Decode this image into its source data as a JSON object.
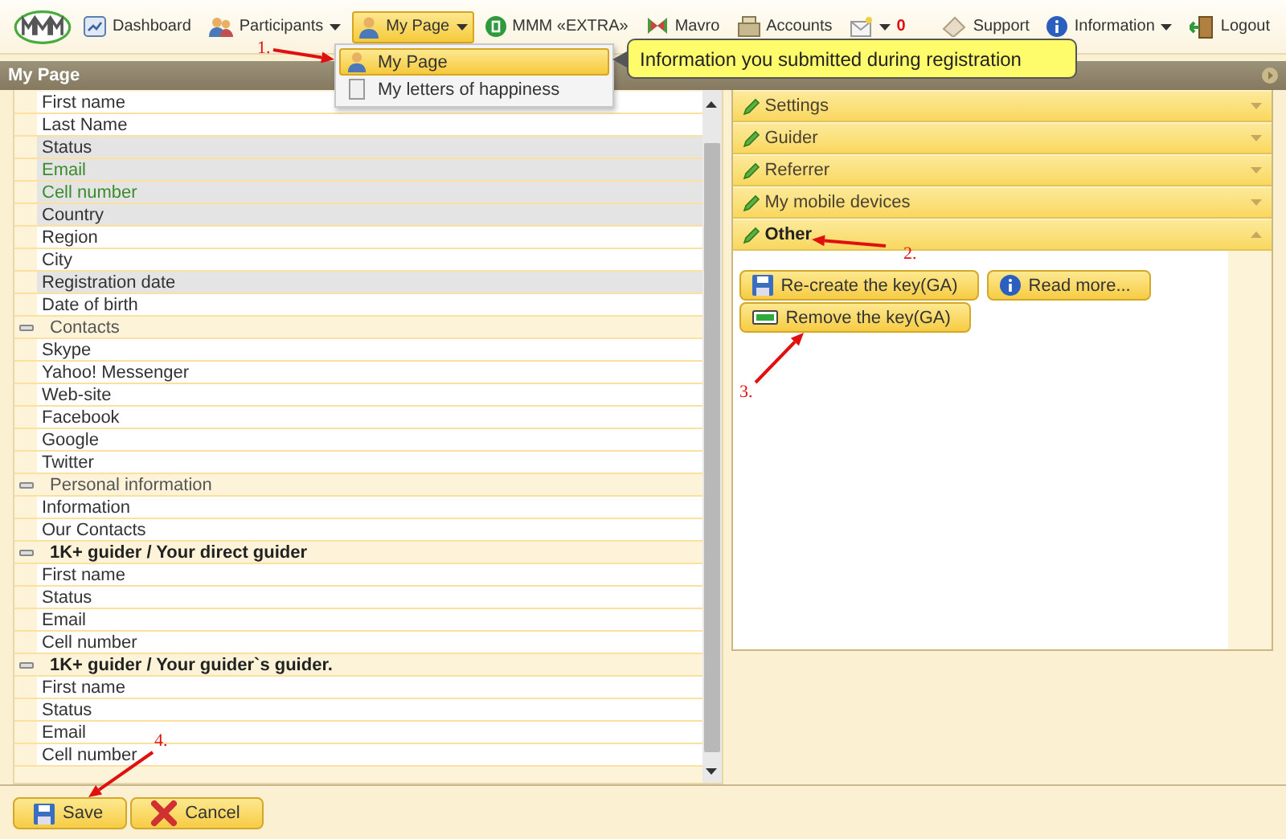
{
  "nav": [
    {
      "kind": "dashboard",
      "label": "Dashboard",
      "dropdown": false,
      "selected": false
    },
    {
      "kind": "participants",
      "label": "Participants",
      "dropdown": true,
      "selected": false
    },
    {
      "kind": "mypage",
      "label": "My Page",
      "dropdown": true,
      "selected": true
    },
    {
      "kind": "extra",
      "label": "MMM «EXTRA»",
      "dropdown": false,
      "selected": false
    },
    {
      "kind": "mavro",
      "label": "Mavro",
      "dropdown": false,
      "selected": false
    },
    {
      "kind": "accounts",
      "label": "Accounts",
      "dropdown": false,
      "selected": false
    },
    {
      "kind": "mail",
      "count": "0",
      "dropdown": true,
      "selected": false
    },
    {
      "kind": "support",
      "label": "Support",
      "dropdown": false,
      "selected": false
    },
    {
      "kind": "information",
      "label": "Information",
      "dropdown": true,
      "selected": false
    },
    {
      "kind": "logout",
      "label": "Logout",
      "dropdown": false,
      "selected": false
    }
  ],
  "menu": [
    {
      "label": "My Page",
      "selected": true
    },
    {
      "label": "My letters of happiness",
      "selected": false
    }
  ],
  "tooltip": "Information you submitted during registration",
  "page_title": "My Page",
  "fields": [
    {
      "kind": "field",
      "label": "First name",
      "shaded": false,
      "color": "#333333"
    },
    {
      "kind": "field",
      "label": "Last Name",
      "shaded": false,
      "color": "#333333"
    },
    {
      "kind": "field",
      "label": "Status",
      "shaded": true,
      "color": "#333333"
    },
    {
      "kind": "field",
      "label": "Email",
      "shaded": true,
      "color": "#3c8c2c"
    },
    {
      "kind": "field",
      "label": "Cell number",
      "shaded": true,
      "color": "#3c8c2c"
    },
    {
      "kind": "field",
      "label": "Country",
      "shaded": true,
      "color": "#333333"
    },
    {
      "kind": "field",
      "label": "Region",
      "shaded": false,
      "color": "#333333"
    },
    {
      "kind": "field",
      "label": "City",
      "shaded": false,
      "color": "#333333"
    },
    {
      "kind": "field",
      "label": "Registration date",
      "shaded": true,
      "color": "#333333"
    },
    {
      "kind": "field",
      "label": "Date of birth",
      "shaded": false,
      "color": "#333333"
    },
    {
      "kind": "group",
      "label": "Contacts",
      "bold": false,
      "expanded": true
    },
    {
      "kind": "field",
      "label": "Skype",
      "shaded": false,
      "color": "#333333"
    },
    {
      "kind": "field",
      "label": "Yahoo! Messenger",
      "shaded": false,
      "color": "#333333"
    },
    {
      "kind": "field",
      "label": "Web-site",
      "shaded": false,
      "color": "#333333"
    },
    {
      "kind": "field",
      "label": "Facebook",
      "shaded": false,
      "color": "#333333"
    },
    {
      "kind": "field",
      "label": "Google",
      "shaded": false,
      "color": "#333333"
    },
    {
      "kind": "field",
      "label": "Twitter",
      "shaded": false,
      "color": "#333333"
    },
    {
      "kind": "group",
      "label": "Personal information",
      "bold": false,
      "expanded": true
    },
    {
      "kind": "field",
      "label": "Information",
      "shaded": false,
      "color": "#333333"
    },
    {
      "kind": "field",
      "label": "Our Contacts",
      "shaded": false,
      "color": "#333333"
    },
    {
      "kind": "group",
      "label": "1K+ guider / Your direct guider",
      "bold": true,
      "expanded": true
    },
    {
      "kind": "field",
      "label": "First name",
      "shaded": false,
      "color": "#333333"
    },
    {
      "kind": "field",
      "label": "Status",
      "shaded": false,
      "color": "#333333"
    },
    {
      "kind": "field",
      "label": "Email",
      "shaded": false,
      "color": "#333333"
    },
    {
      "kind": "field",
      "label": "Cell number",
      "shaded": false,
      "color": "#333333"
    },
    {
      "kind": "group",
      "label": "1K+ guider / Your guider`s guider.",
      "bold": true,
      "expanded": true
    },
    {
      "kind": "field",
      "label": "First name",
      "shaded": false,
      "color": "#333333"
    },
    {
      "kind": "field",
      "label": "Status",
      "shaded": false,
      "color": "#333333"
    },
    {
      "kind": "field",
      "label": "Email",
      "shaded": false,
      "color": "#333333"
    },
    {
      "kind": "field",
      "label": "Cell number",
      "shaded": false,
      "color": "#333333"
    }
  ],
  "sections": [
    {
      "label": "Settings",
      "expanded": false
    },
    {
      "label": "Guider",
      "expanded": false
    },
    {
      "label": "Referrer",
      "expanded": false
    },
    {
      "label": "My mobile devices",
      "expanded": false
    },
    {
      "label": "Other",
      "expanded": true
    }
  ],
  "section_buttons": [
    {
      "kind": "save",
      "label": "Re-create the key(GA)"
    },
    {
      "kind": "info",
      "label": "Read more..."
    },
    {
      "kind": "remove",
      "label": "Remove the key(GA)"
    }
  ],
  "footer_buttons": [
    {
      "kind": "save",
      "label": "Save"
    },
    {
      "kind": "cancel",
      "label": "Cancel"
    }
  ],
  "annotations": [
    "1.",
    "2.",
    "3.",
    "4."
  ]
}
